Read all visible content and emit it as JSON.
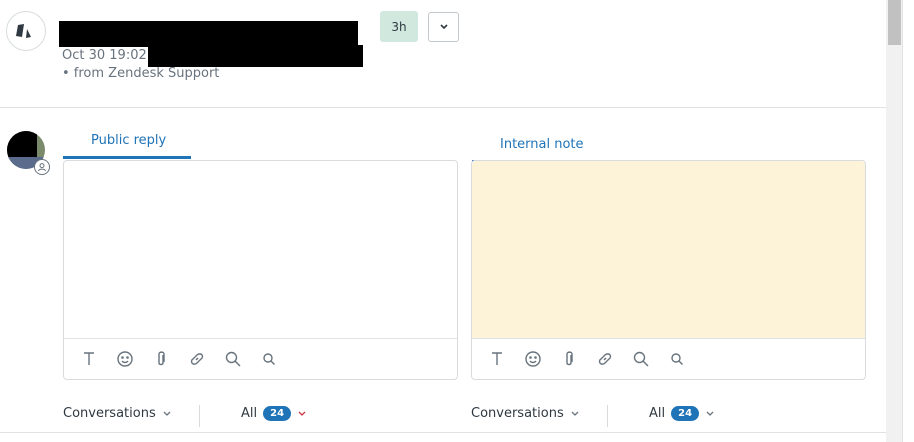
{
  "header": {
    "time_badge": "3h",
    "timestamp": "Oct 30 19:02 •",
    "source": "• from Zendesk Support"
  },
  "composer": {
    "left": {
      "tab_label": "Public reply",
      "toolbar_icons": [
        "text-format-icon",
        "emoji-icon",
        "attachment-icon",
        "link-icon",
        "search-icon",
        "search-small-icon"
      ],
      "background": "#ffffff"
    },
    "right": {
      "tab_label": "Internal note",
      "toolbar_icons": [
        "text-format-icon",
        "emoji-icon",
        "attachment-icon",
        "link-icon",
        "search-icon",
        "search-small-icon"
      ],
      "background": "#fdf3d8"
    }
  },
  "footer": {
    "left": {
      "conversations_label": "Conversations",
      "filter_label": "All",
      "count": "24"
    },
    "right": {
      "conversations_label": "Conversations",
      "filter_label": "All",
      "count": "24"
    }
  },
  "colors": {
    "accent": "#1f73b7",
    "badge_bg": "#d1e8df",
    "note_bg": "#fdf3d8"
  }
}
